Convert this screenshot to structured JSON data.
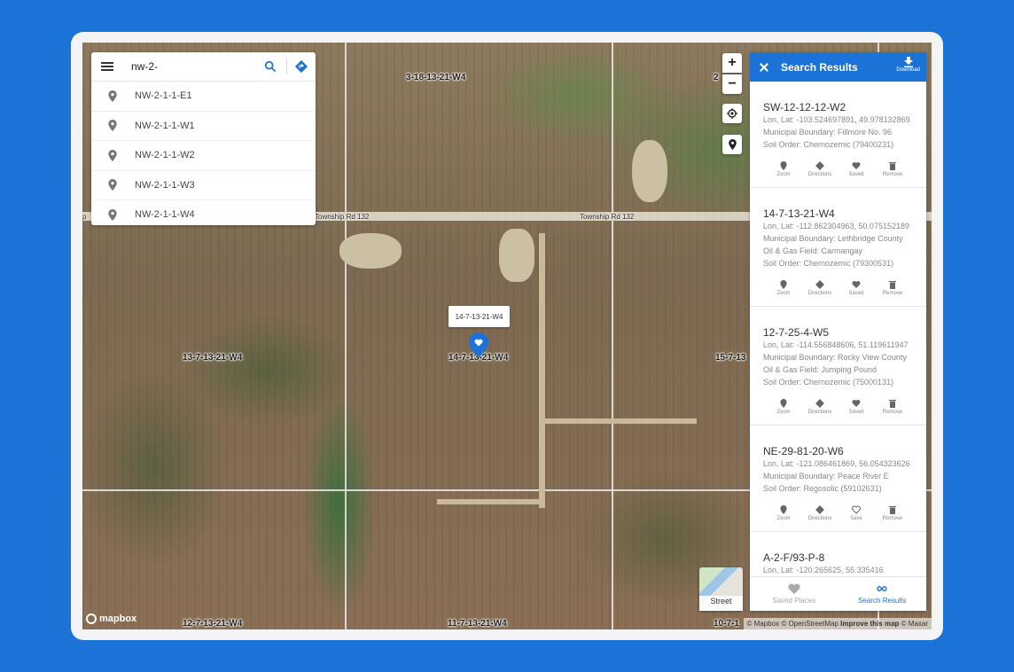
{
  "search": {
    "value": "nw-2-",
    "suggestions": [
      "NW-2-1-1-E1",
      "NW-2-1-1-W1",
      "NW-2-1-1-W2",
      "NW-2-1-1-W3",
      "NW-2-1-1-W4"
    ]
  },
  "map": {
    "labels": {
      "top_center": "3-18-13-21-W4",
      "top_right": "2",
      "mid_left": "13-7-13-21-W4",
      "mid_center": "14-7-13-21-W4",
      "mid_right": "15-7-13",
      "bottom_left": "12-7-13-21-W4",
      "bottom_center": "11-7-13-21-W4",
      "bottom_right": "10-7-1"
    },
    "road_labels": {
      "left": "Township Rd 132",
      "right": "Township Rd 132",
      "edge": "p"
    },
    "tooltip": "14-7-13-21-W4",
    "logo": "mapbox",
    "attribution": {
      "mapbox": "© Mapbox",
      "osm": "© OpenStreetMap",
      "improve": "Improve this map",
      "maxar": "© Maxar"
    },
    "street_toggle": "Street",
    "zoom_in": "+",
    "zoom_out": "−"
  },
  "results": {
    "title": "Search Results",
    "download_label": "Download",
    "items": [
      {
        "name": "SW-12-12-12-W2",
        "lines": [
          "Lon, Lat: -103.524697891, 49.978132869",
          "Municipal Boundary: Fillmore No. 96",
          "Soil Order: Chernozemic (79400231)"
        ],
        "save_label": "Saved"
      },
      {
        "name": "14-7-13-21-W4",
        "lines": [
          "Lon, Lat: -112.862304963, 50.075152189",
          "Municipal Boundary: Lethbridge County",
          "Oil & Gas Field: Carmangay",
          "Soil Order: Chernozemic (79300531)"
        ],
        "save_label": "Saved"
      },
      {
        "name": "12-7-25-4-W5",
        "lines": [
          "Lon, Lat: -114.556848606, 51.119611947",
          "Municipal Boundary: Rocky View County",
          "Oil & Gas Field: Jumping Pound",
          "Soil Order: Chernozemic (75000131)"
        ],
        "save_label": "Saved"
      },
      {
        "name": "NE-29-81-20-W6",
        "lines": [
          "Lon, Lat: -121.086461869, 56.054323626",
          "Municipal Boundary: Peace River E",
          "Soil Order: Regosolic (59102631)"
        ],
        "save_label": "Save"
      },
      {
        "name": "A-2-F/93-P-8",
        "lines": [
          "Lon, Lat: -120.265625, 55.335416"
        ],
        "save_label": "Save"
      }
    ],
    "actions": {
      "zoom": "Zoom",
      "directions": "Directions",
      "remove": "Remove"
    },
    "tabs": {
      "saved": "Saved Places",
      "search": "Search Results"
    }
  },
  "colors": {
    "accent": "#1b73d8",
    "background": "#1b73d8"
  }
}
